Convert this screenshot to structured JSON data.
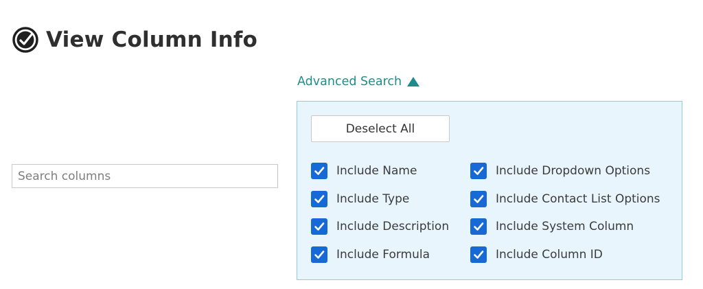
{
  "header": {
    "title": "View Column Info",
    "icon": "app-logo-icon"
  },
  "search": {
    "placeholder": "Search columns",
    "value": ""
  },
  "advanced_search": {
    "label": "Advanced Search",
    "expanded": true,
    "deselect_all_label": "Deselect All",
    "options_left": [
      {
        "label": "Include Name",
        "checked": true
      },
      {
        "label": "Include Type",
        "checked": true
      },
      {
        "label": "Include Description",
        "checked": true
      },
      {
        "label": "Include Formula",
        "checked": true
      }
    ],
    "options_right": [
      {
        "label": "Include Dropdown Options",
        "checked": true
      },
      {
        "label": "Include Contact List Options",
        "checked": true
      },
      {
        "label": "Include System Column",
        "checked": true
      },
      {
        "label": "Include Column ID",
        "checked": true
      }
    ]
  },
  "colors": {
    "accent": "#1e8c8a",
    "checkbox": "#1769d6",
    "panel_bg": "#e9f5fc",
    "panel_border": "#8ccbe3"
  }
}
